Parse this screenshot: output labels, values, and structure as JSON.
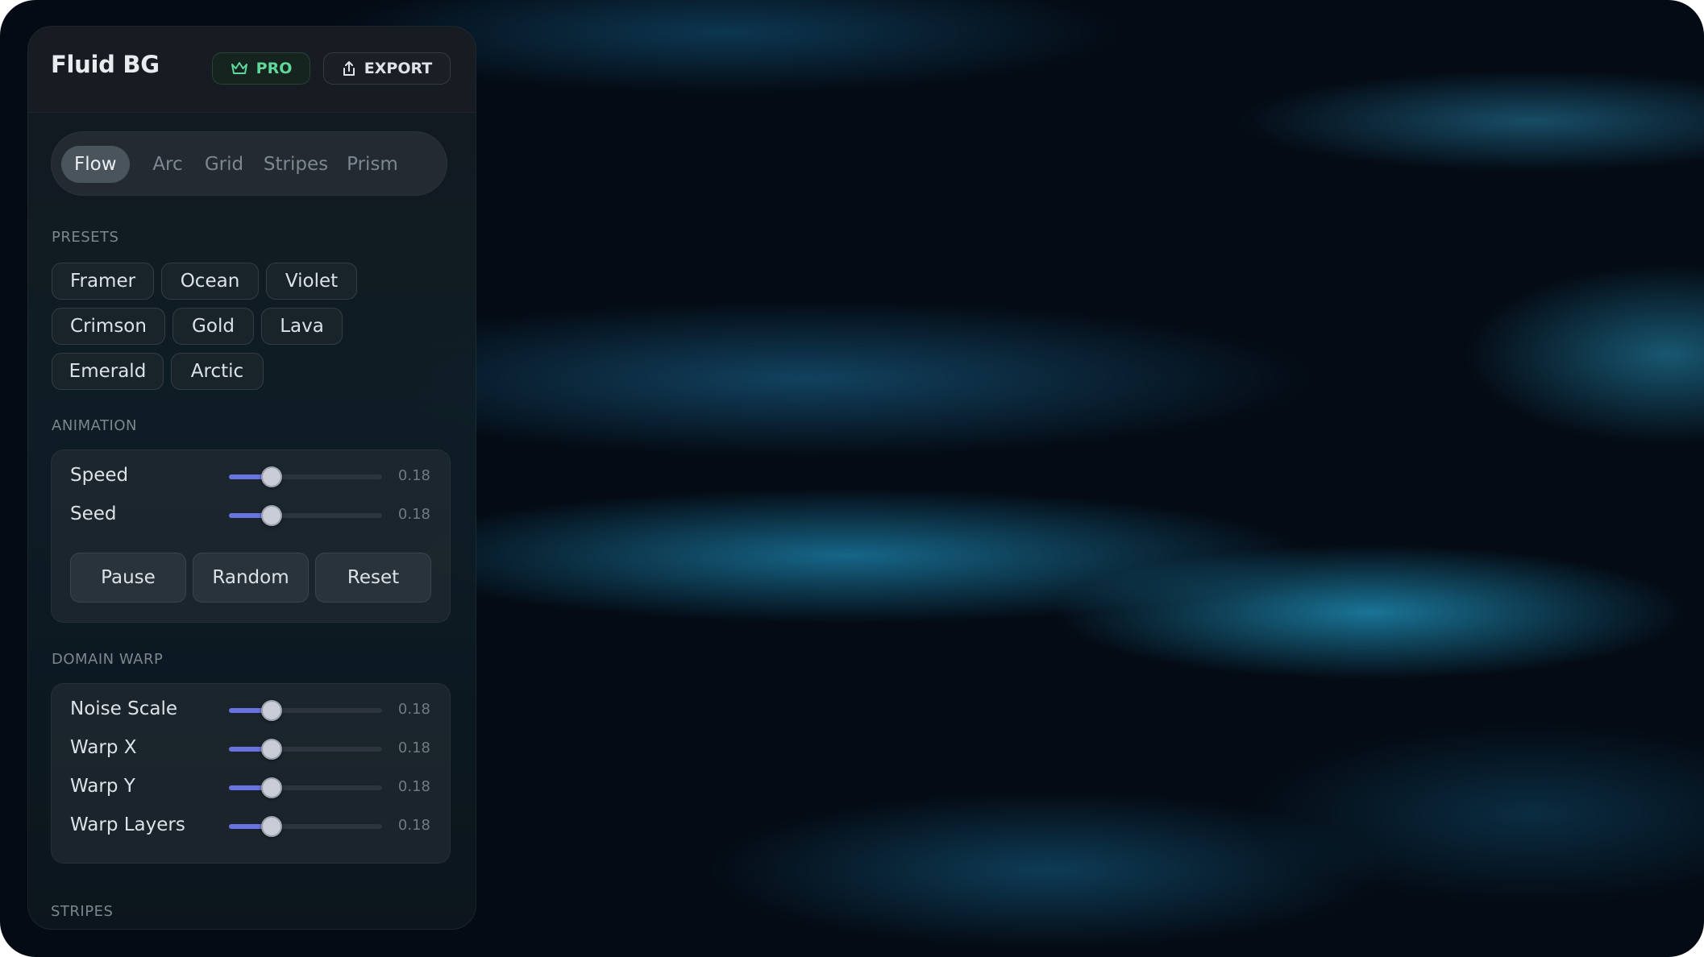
{
  "app": {
    "title": "Fluid BG"
  },
  "header": {
    "pro": {
      "label": "PRO",
      "icon": "crown-icon",
      "color": "#5fd69a"
    },
    "export": {
      "label": "EXPORT",
      "icon": "share-upload-icon"
    }
  },
  "tabs": [
    {
      "label": "Flow",
      "active": true
    },
    {
      "label": "Arc",
      "active": false
    },
    {
      "label": "Grid",
      "active": false
    },
    {
      "label": "Stripes",
      "active": false
    },
    {
      "label": "Prism",
      "active": false
    }
  ],
  "presets": {
    "label": "PRESETS",
    "items": [
      "Framer",
      "Ocean",
      "Violet",
      "Crimson",
      "Gold",
      "Lava",
      "Emerald",
      "Arctic"
    ]
  },
  "animation": {
    "label": "ANIMATION",
    "sliders": [
      {
        "label": "Speed",
        "value": "0.18",
        "level": 0.28
      },
      {
        "label": "Seed",
        "value": "0.18",
        "level": 0.28
      }
    ],
    "buttons": [
      "Pause",
      "Random",
      "Reset"
    ]
  },
  "domain_warp": {
    "label": "DOMAIN WARP",
    "sliders": [
      {
        "label": "Noise Scale",
        "value": "0.18",
        "level": 0.28
      },
      {
        "label": "Warp X",
        "value": "0.18",
        "level": 0.28
      },
      {
        "label": "Warp Y",
        "value": "0.18",
        "level": 0.28
      },
      {
        "label": "Warp Layers",
        "value": "0.18",
        "level": 0.28
      }
    ]
  },
  "stripes": {
    "label": "STRIPES"
  },
  "colors": {
    "accent": "#6a74e0",
    "background": "#040b14"
  }
}
